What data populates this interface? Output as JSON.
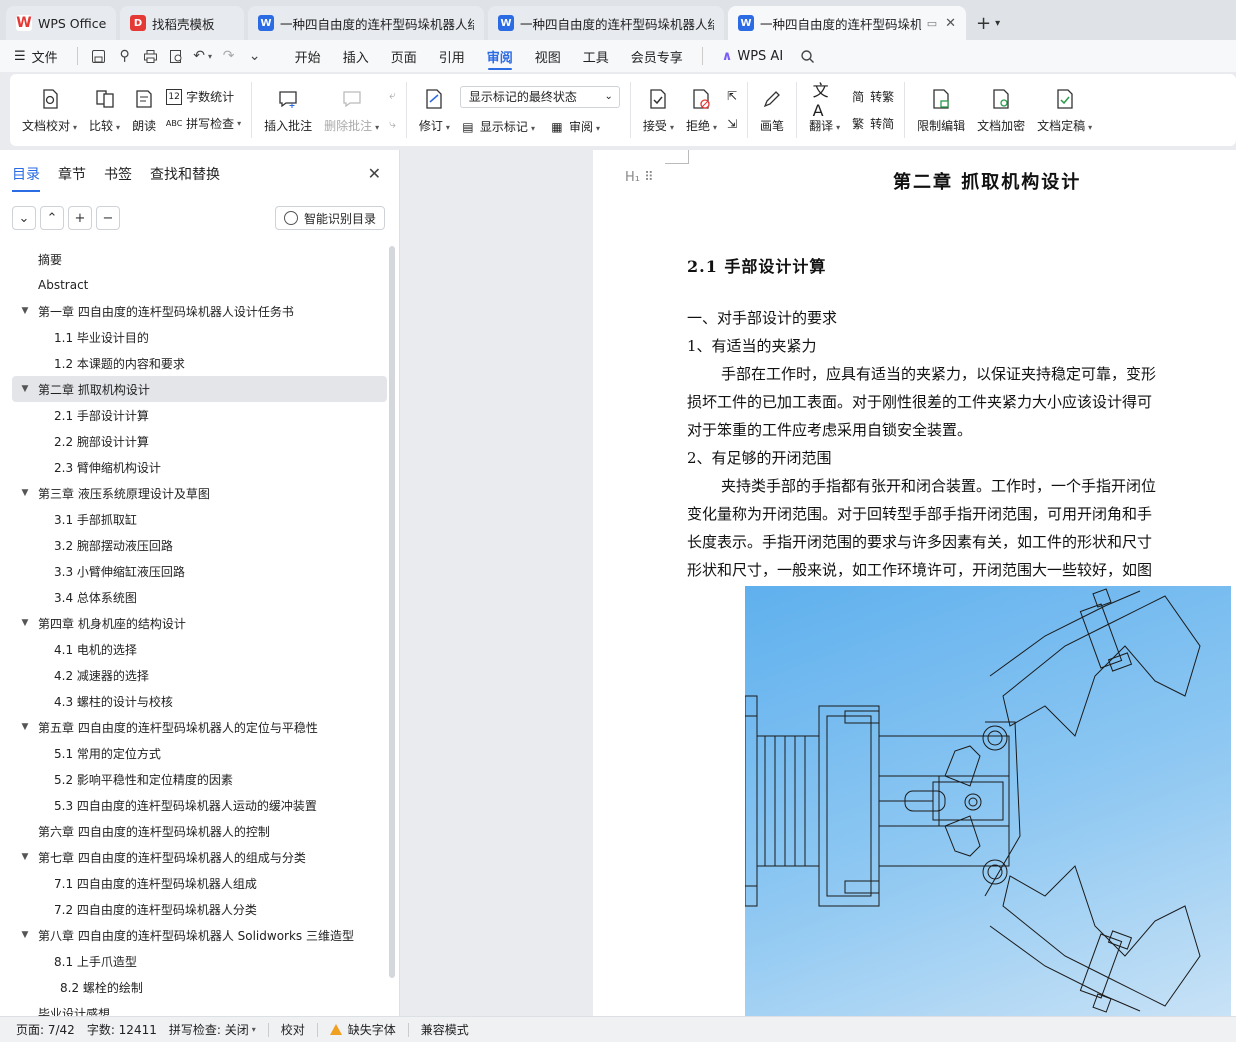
{
  "tabs": [
    {
      "label": "WPS Office",
      "icon": "wps-logo-icon",
      "active": false
    },
    {
      "label": "找稻壳模板",
      "icon": "docer-icon",
      "active": false
    },
    {
      "label": "一种四自由度的连杆型码垛机器人结构",
      "icon": "word-doc-icon",
      "active": false
    },
    {
      "label": "一种四自由度的连杆型码垛机器人结构",
      "icon": "word-doc-icon",
      "active": false
    },
    {
      "label": "一种四自由度的连杆型码垛机器人",
      "icon": "word-doc-icon",
      "active": true
    }
  ],
  "menubar": {
    "file": "文件",
    "items": [
      "开始",
      "插入",
      "页面",
      "引用",
      "审阅",
      "视图",
      "工具",
      "会员专享"
    ],
    "active": "审阅",
    "wps_ai": "WPS AI"
  },
  "ribbon": {
    "doc_check": "文档校对",
    "compare": "比较",
    "read_aloud": "朗读",
    "word_count": "字数统计",
    "spell_check": "拼写检查",
    "insert_comment": "插入批注",
    "delete_comment": "删除批注",
    "revise": "修订",
    "markup_state": "显示标记的最终状态",
    "show_markup": "显示标记",
    "review": "审阅",
    "accept": "接受",
    "reject": "拒绝",
    "pen": "画笔",
    "translate": "翻译",
    "to_traditional": "转繁",
    "to_simplified": "转简",
    "restrict_edit": "限制编辑",
    "encrypt": "文档加密",
    "finalize": "文档定稿"
  },
  "panel": {
    "tabs": [
      "目录",
      "章节",
      "书签",
      "查找和替换"
    ],
    "active_tab": "目录",
    "smart_toc": "智能识别目录",
    "toc": [
      {
        "label": "摘要",
        "level": 0,
        "arrow": false,
        "selected": false
      },
      {
        "label": "Abstract",
        "level": 0,
        "arrow": false,
        "selected": false
      },
      {
        "label": "第一章 四自由度的连杆型码垛机器人设计任务书",
        "level": 1,
        "arrow": true,
        "selected": false
      },
      {
        "label": "1.1 毕业设计目的",
        "level": 2,
        "arrow": false,
        "selected": false
      },
      {
        "label": "1.2 本课题的内容和要求",
        "level": 2,
        "arrow": false,
        "selected": false
      },
      {
        "label": "第二章 抓取机构设计",
        "level": 1,
        "arrow": true,
        "selected": true
      },
      {
        "label": "2.1 手部设计计算",
        "level": 2,
        "arrow": false,
        "selected": false
      },
      {
        "label": "2.2 腕部设计计算",
        "level": 2,
        "arrow": false,
        "selected": false
      },
      {
        "label": "2.3 臂伸缩机构设计",
        "level": 2,
        "arrow": false,
        "selected": false
      },
      {
        "label": "第三章 液压系统原理设计及草图",
        "level": 1,
        "arrow": true,
        "selected": false
      },
      {
        "label": "3.1 手部抓取缸",
        "level": 2,
        "arrow": false,
        "selected": false
      },
      {
        "label": "3.2 腕部摆动液压回路",
        "level": 2,
        "arrow": false,
        "selected": false
      },
      {
        "label": "3.3 小臂伸缩缸液压回路",
        "level": 2,
        "arrow": false,
        "selected": false
      },
      {
        "label": "3.4 总体系统图",
        "level": 2,
        "arrow": false,
        "selected": false
      },
      {
        "label": "第四章 机身机座的结构设计",
        "level": 1,
        "arrow": true,
        "selected": false
      },
      {
        "label": "4.1 电机的选择",
        "level": 2,
        "arrow": false,
        "selected": false
      },
      {
        "label": "4.2 减速器的选择",
        "level": 2,
        "arrow": false,
        "selected": false
      },
      {
        "label": "4.3 螺柱的设计与校核",
        "level": 2,
        "arrow": false,
        "selected": false
      },
      {
        "label": "第五章 四自由度的连杆型码垛机器人的定位与平稳性",
        "level": 1,
        "arrow": true,
        "selected": false
      },
      {
        "label": "5.1 常用的定位方式",
        "level": 2,
        "arrow": false,
        "selected": false
      },
      {
        "label": "5.2 影响平稳性和定位精度的因素",
        "level": 2,
        "arrow": false,
        "selected": false
      },
      {
        "label": "5.3 四自由度的连杆型码垛机器人运动的缓冲装置",
        "level": 2,
        "arrow": false,
        "selected": false
      },
      {
        "label": "第六章 四自由度的连杆型码垛机器人的控制",
        "level": 0,
        "arrow": false,
        "selected": false
      },
      {
        "label": "第七章 四自由度的连杆型码垛机器人的组成与分类",
        "level": 1,
        "arrow": true,
        "selected": false
      },
      {
        "label": "7.1 四自由度的连杆型码垛机器人组成",
        "level": 2,
        "arrow": false,
        "selected": false
      },
      {
        "label": "7.2 四自由度的连杆型码垛机器人分类",
        "level": 2,
        "arrow": false,
        "selected": false
      },
      {
        "label": "第八章 四自由度的连杆型码垛机器人 Solidworks 三维造型",
        "level": 1,
        "arrow": true,
        "selected": false
      },
      {
        "label": "8.1 上手爪造型",
        "level": 2,
        "arrow": false,
        "selected": false
      },
      {
        "label": "8.2 螺栓的绘制",
        "level": 3,
        "arrow": false,
        "selected": false
      },
      {
        "label": "毕业设计感想",
        "level": 0,
        "arrow": false,
        "selected": false
      }
    ]
  },
  "document": {
    "chapter_title": "第二章  抓取机构设计",
    "section_title": "2.1 手部设计计算",
    "lines": [
      {
        "text": "一、对手部设计的要求",
        "indent": false
      },
      {
        "text": "1、有适当的夹紧力",
        "indent": false
      },
      {
        "text": "手部在工作时，应具有适当的夹紧力，以保证夹持稳定可靠，变形",
        "indent": true
      },
      {
        "text": "损坏工件的已加工表面。对于刚性很差的工件夹紧力大小应该设计得可",
        "indent": false
      },
      {
        "text": "对于笨重的工件应考虑采用自锁安全装置。",
        "indent": false
      },
      {
        "text": "2、有足够的开闭范围",
        "indent": false
      },
      {
        "text": "夹持类手部的手指都有张开和闭合装置。工作时，一个手指开闭位",
        "indent": true
      },
      {
        "text": "变化量称为开闭范围。对于回转型手部手指开闭范围，可用开闭角和手",
        "indent": false
      },
      {
        "text": "长度表示。手指开闭范围的要求与许多因素有关，如工件的形状和尺寸",
        "indent": false
      },
      {
        "text": "形状和尺寸，一般来说，如工作环境许可，开闭范围大一些较好，如图",
        "indent": false
      }
    ]
  },
  "statusbar": {
    "page": "页面: 7/42",
    "words": "字数: 12411",
    "spell": "拼写检查: 关闭",
    "proof": "校对",
    "missing_font": "缺失字体",
    "compat": "兼容模式"
  },
  "colors": {
    "accent": "#2b6be4",
    "warning": "#f0a020"
  }
}
